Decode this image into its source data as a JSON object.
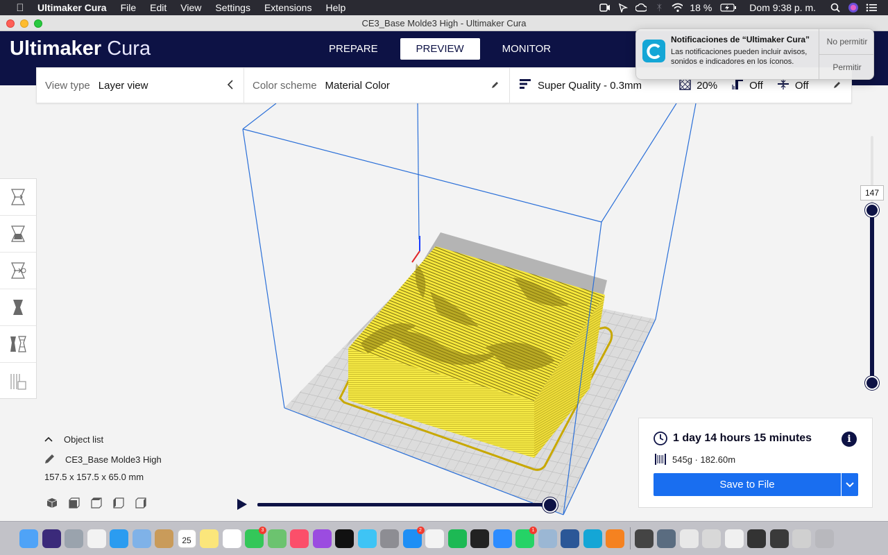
{
  "menubar": {
    "app_name": "Ultimaker Cura",
    "menus": [
      "File",
      "Edit",
      "View",
      "Settings",
      "Extensions",
      "Help"
    ],
    "battery": "18 %",
    "clock": "Dom 9:38 p. m.",
    "status_icons": [
      "facetime-icon",
      "cursor-icon",
      "creative-cloud-icon",
      "bluetooth-icon",
      "wifi-icon",
      "battery-icon",
      "search-icon",
      "siri-icon",
      "notification-center-icon"
    ]
  },
  "window": {
    "title": "CE3_Base Molde3 High - Ultimaker Cura"
  },
  "header": {
    "logo_light": "Ultimaker",
    "logo_bold": "Cura",
    "tabs": [
      {
        "label": "PREPARE",
        "active": false
      },
      {
        "label": "PREVIEW",
        "active": true
      },
      {
        "label": "MONITOR",
        "active": false
      }
    ]
  },
  "settings_strip": {
    "view_type_label": "View type",
    "view_type_value": "Layer view",
    "color_scheme_label": "Color scheme",
    "color_scheme_value": "Material Color",
    "profile": "Super Quality - 0.3mm",
    "infill": "20%",
    "support": "Off",
    "adhesion": "Off"
  },
  "toolbar": {
    "tools": [
      "move-tool-icon",
      "scale-tool-icon",
      "rotate-tool-icon",
      "mirror-tool-icon",
      "per-model-settings-icon",
      "support-blocker-icon"
    ]
  },
  "layer_slider": {
    "current_layer": "147",
    "fraction": 1.0
  },
  "object_list": {
    "header": "Object list",
    "object_name": "CE3_Base Molde3 High",
    "dimensions": "157.5 x 157.5 x 65.0 mm",
    "view_buttons": [
      "view-3d-icon",
      "view-front-icon",
      "view-top-icon",
      "view-left-icon",
      "view-right-icon"
    ]
  },
  "path_slider": {
    "fraction": 1.0
  },
  "print_info": {
    "time": "1 day 14 hours 15 minutes",
    "material": "545g · 182.60m",
    "save_label": "Save to File"
  },
  "notification": {
    "title": "Notificaciones de “Ultimaker Cura”",
    "body": "Las notificaciones pueden incluir avisos, sonidos e indicadores en los íconos.",
    "deny_label": "No permitir",
    "allow_label": "Permitir"
  },
  "colors": {
    "cura_blue": "#0d1245",
    "save_blue": "#196ef0",
    "model_yellow": "#f7e83a",
    "build_volume": "#2a6fd8"
  },
  "dock": {
    "apps": [
      {
        "name": "finder-icon",
        "color": "#4fa3f7"
      },
      {
        "name": "siri-icon",
        "color": "#3b2a7a"
      },
      {
        "name": "launchpad-icon",
        "color": "#9aa3ad"
      },
      {
        "name": "photos-icon",
        "color": "#f2f2f2"
      },
      {
        "name": "safari-icon",
        "color": "#2b9cf0"
      },
      {
        "name": "preview-icon",
        "color": "#7fb2e8"
      },
      {
        "name": "contacts-icon",
        "color": "#c99b5a"
      },
      {
        "name": "calendar-icon",
        "color": "#ffffff",
        "label": "25"
      },
      {
        "name": "notes-icon",
        "color": "#fbe67b"
      },
      {
        "name": "reminders-icon",
        "color": "#ffffff"
      },
      {
        "name": "facetime-icon",
        "color": "#34c759",
        "badge": "3"
      },
      {
        "name": "maps-icon",
        "color": "#6cc36f"
      },
      {
        "name": "music-icon",
        "color": "#fb4f6a"
      },
      {
        "name": "podcasts-icon",
        "color": "#9b4ce0"
      },
      {
        "name": "tv-icon",
        "color": "#111111"
      },
      {
        "name": "messages-icon",
        "color": "#3ec4f5"
      },
      {
        "name": "system-preferences-icon",
        "color": "#8d8d93"
      },
      {
        "name": "app-store-icon",
        "color": "#1e8ff5",
        "badge": "2"
      },
      {
        "name": "chrome-icon",
        "color": "#f3f3f3"
      },
      {
        "name": "spotify-icon",
        "color": "#1db954"
      },
      {
        "name": "terminal-icon",
        "color": "#222222"
      },
      {
        "name": "zoom-icon",
        "color": "#2d8cff"
      },
      {
        "name": "whatsapp-icon",
        "color": "#25d366",
        "badge": "1"
      },
      {
        "name": "image-capture-icon",
        "color": "#9bb7d4"
      },
      {
        "name": "word-icon",
        "color": "#2b5797"
      },
      {
        "name": "cura-icon",
        "color": "#14a6d6"
      },
      {
        "name": "fusion360-icon",
        "color": "#f58220"
      }
    ],
    "docs": [
      {
        "name": "doc-thumb-1-icon",
        "color": "#444444"
      },
      {
        "name": "doc-thumb-2-icon",
        "color": "#5a6c80"
      },
      {
        "name": "doc-thumb-3-icon",
        "color": "#e8e8e8"
      },
      {
        "name": "doc-thumb-4-icon",
        "color": "#d8d8d8"
      },
      {
        "name": "doc-thumb-5-icon",
        "color": "#f0f0f0"
      },
      {
        "name": "doc-thumb-6-icon",
        "color": "#333333"
      },
      {
        "name": "doc-thumb-7-icon",
        "color": "#3a3a3a"
      },
      {
        "name": "doc-thumb-8-icon",
        "color": "#d0d0d0"
      },
      {
        "name": "trash-icon",
        "color": "#b8b8bd"
      }
    ]
  }
}
